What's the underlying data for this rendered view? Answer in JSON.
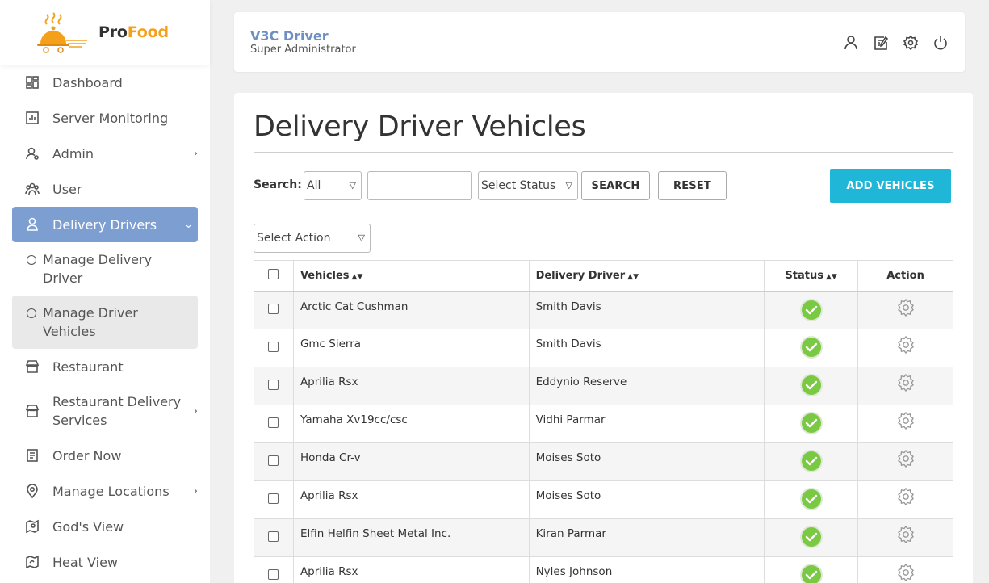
{
  "brand": {
    "pro": "Pro",
    "food": "Food"
  },
  "sidebar": {
    "items": [
      {
        "label": "Dashboard",
        "icon": "dashboard-icon"
      },
      {
        "label": "Server Monitoring",
        "icon": "chart-icon"
      },
      {
        "label": "Admin",
        "icon": "admin-user-icon"
      },
      {
        "label": "User",
        "icon": "users-icon"
      },
      {
        "label": "Delivery Drivers",
        "icon": "driver-icon"
      },
      {
        "label": "Restaurant",
        "icon": "store-icon"
      },
      {
        "label": "Restaurant Delivery Services",
        "icon": "store-icon"
      },
      {
        "label": "Order Now",
        "icon": "document-icon"
      },
      {
        "label": "Manage Locations",
        "icon": "location-pin-icon"
      },
      {
        "label": "God's View",
        "icon": "map-pin-icon"
      },
      {
        "label": "Heat View",
        "icon": "heat-map-icon"
      }
    ],
    "sub_items": [
      {
        "label": "Manage Delivery Driver"
      },
      {
        "label": "Manage Driver Vehicles"
      }
    ]
  },
  "header": {
    "title": "V3C Driver",
    "subtitle": "Super Administrator",
    "icons": [
      "profile-icon",
      "edit-icon",
      "settings-icon",
      "power-icon"
    ]
  },
  "page": {
    "title": "Delivery Driver Vehicles",
    "search_label": "Search:",
    "search_scope": "All",
    "search_value": "",
    "status_select": "Select Status",
    "search_button": "SEARCH",
    "reset_button": "RESET",
    "add_button": "ADD VEHICLES",
    "action_select": "Select Action"
  },
  "table": {
    "headers": {
      "vehicles": "Vehicles",
      "driver": "Delivery Driver",
      "status": "Status",
      "action": "Action"
    },
    "rows": [
      {
        "vehicle": "Arctic Cat Cushman",
        "driver": "Smith Davis",
        "status": "active"
      },
      {
        "vehicle": "Gmc Sierra",
        "driver": "Smith Davis",
        "status": "active"
      },
      {
        "vehicle": "Aprilia Rsx",
        "driver": "Eddynio Reserve",
        "status": "active"
      },
      {
        "vehicle": "Yamaha Xv19cc/csc",
        "driver": "Vidhi Parmar",
        "status": "active"
      },
      {
        "vehicle": "Honda Cr-v",
        "driver": "Moises Soto",
        "status": "active"
      },
      {
        "vehicle": "Aprilia Rsx",
        "driver": "Moises Soto",
        "status": "active"
      },
      {
        "vehicle": "Elfin Helfin Sheet Metal Inc.",
        "driver": "Kiran Parmar",
        "status": "active"
      },
      {
        "vehicle": "Aprilia Rsx",
        "driver": "Nyles Johnson",
        "status": "active"
      }
    ]
  },
  "colors": {
    "accent": "#7d9ed1",
    "add_button": "#1fb6d8",
    "status_green": "#7ac943",
    "brand_orange": "#f5a01a"
  }
}
